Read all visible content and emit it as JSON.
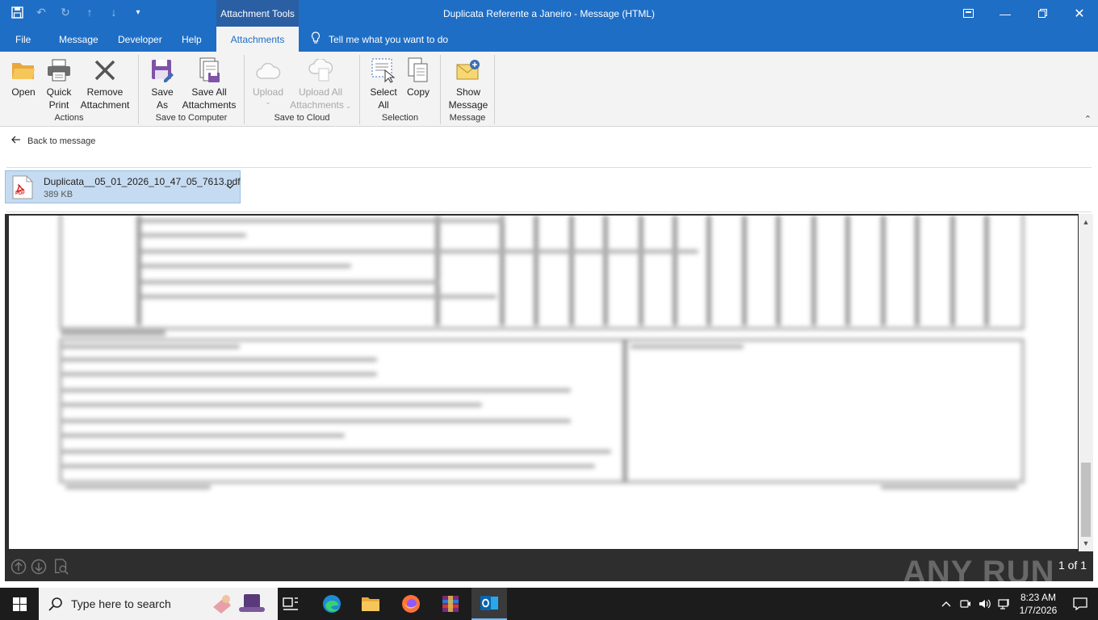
{
  "window": {
    "title": "Duplicata Referente a Janeiro  -  Message (HTML)",
    "context_tab_header": "Attachment Tools"
  },
  "tabs": [
    {
      "label": "File"
    },
    {
      "label": "Message"
    },
    {
      "label": "Developer"
    },
    {
      "label": "Help"
    },
    {
      "label": "Attachments"
    }
  ],
  "active_tab": "Attachments",
  "tell_me": "Tell me what you want to do",
  "ribbon": {
    "actions": {
      "label": "Actions",
      "open": "Open",
      "quick_print": [
        "Quick",
        "Print"
      ],
      "remove": [
        "Remove",
        "Attachment"
      ]
    },
    "save_to_computer": {
      "label": "Save to Computer",
      "save_as": [
        "Save",
        "As"
      ],
      "save_all": [
        "Save All",
        "Attachments"
      ]
    },
    "save_to_cloud": {
      "label": "Save to Cloud",
      "upload": "Upload",
      "upload_all": [
        "Upload All",
        "Attachments"
      ]
    },
    "selection": {
      "label": "Selection",
      "select_all": [
        "Select",
        "All"
      ],
      "copy": "Copy"
    },
    "message": {
      "label": "Message",
      "show_message": [
        "Show",
        "Message"
      ]
    }
  },
  "back_link": "Back to message",
  "attachment": {
    "filename": "Duplicata__05_01_2026_10_47_05_7613.pdf",
    "size": "389 KB",
    "type_badge": "PDF"
  },
  "preview": {
    "page_indicator": "1 of 1",
    "watermark": "ANY RUN"
  },
  "taskbar": {
    "search_placeholder": "Type here to search",
    "time": "8:23 AM",
    "date": "1/7/2026",
    "apps": [
      "task-view",
      "edge",
      "file-explorer",
      "firefox",
      "winrar",
      "outlook"
    ]
  },
  "colors": {
    "accent": "#1e6ec6",
    "context_tab": "#2b5fa3",
    "attachment_selected": "#c5dbf1",
    "taskbar": "#1c1c1c"
  }
}
